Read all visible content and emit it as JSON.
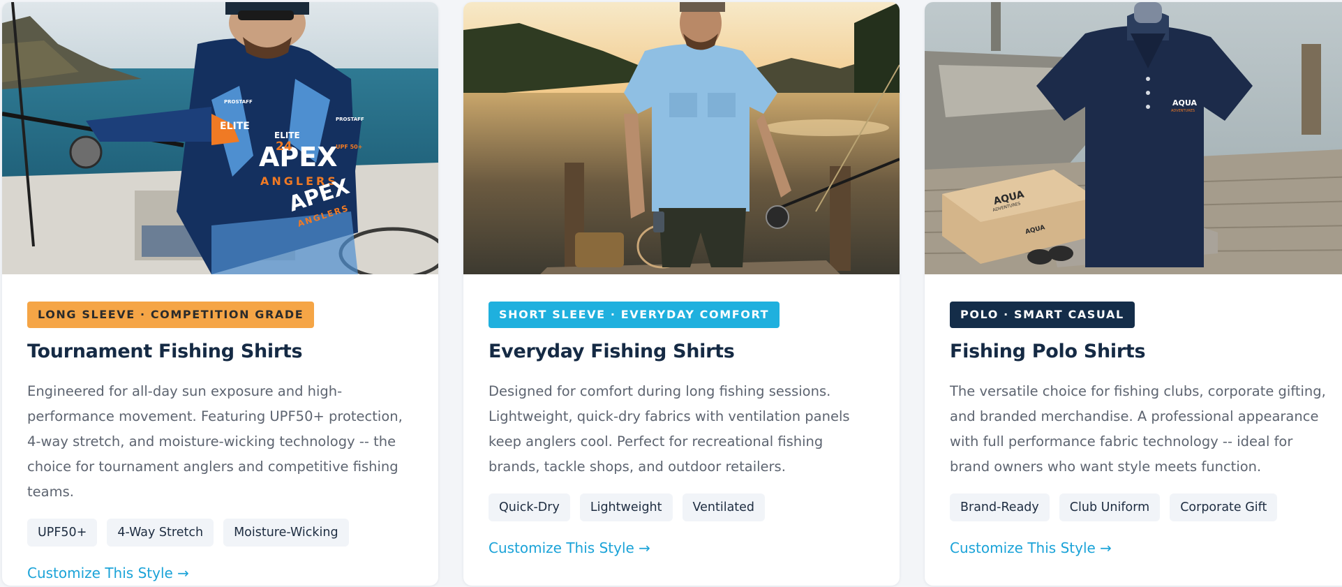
{
  "cards": [
    {
      "badge": "LONG SLEEVE · COMPETITION GRADE",
      "title": "Tournament Fishing Shirts",
      "description": "Engineered for all-day sun exposure and high-performance movement. Featuring UPF50+ protection, 4-way stretch, and moisture-wicking technology -- the choice for tournament anglers and competitive fishing teams.",
      "tags": [
        "UPF50+",
        "4-Way Stretch",
        "Moisture-Wicking"
      ],
      "cta": "Customize This Style →",
      "photo_print": {
        "logo_main": "APEX",
        "logo_sub": "ANGLERS",
        "sleeve": "APEX",
        "elite": "ELITE",
        "number": "24",
        "series": "ELITE",
        "prostaff": "PROSTAFF",
        "upf": "UPF 50+"
      },
      "badge_color": "#f5a546"
    },
    {
      "badge": "SHORT SLEEVE · EVERYDAY COMFORT",
      "title": "Everyday Fishing Shirts",
      "description": "Designed for comfort during long fishing sessions. Lightweight, quick-dry fabrics with ventilation panels keep anglers cool. Perfect for recreational fishing brands, tackle shops, and outdoor retailers.",
      "tags": [
        "Quick-Dry",
        "Lightweight",
        "Ventilated"
      ],
      "cta": "Customize This Style →",
      "badge_color": "#1fb0de"
    },
    {
      "badge": "POLO · SMART CASUAL",
      "title": "Fishing Polo Shirts",
      "description": "The versatile choice for fishing clubs, corporate gifting, and branded merchandise. A professional appearance with full performance fabric technology -- ideal for brand owners who want style meets function.",
      "tags": [
        "Brand-Ready",
        "Club Uniform",
        "Corporate Gift"
      ],
      "cta": "Customize This Style →",
      "photo_print": {
        "polo_logo": "AQUA",
        "polo_logo_sub": "ADVENTURES",
        "box_logo": "AQUA",
        "box_logo_sub": "ADVENTURES"
      },
      "badge_color": "#142d49"
    }
  ]
}
